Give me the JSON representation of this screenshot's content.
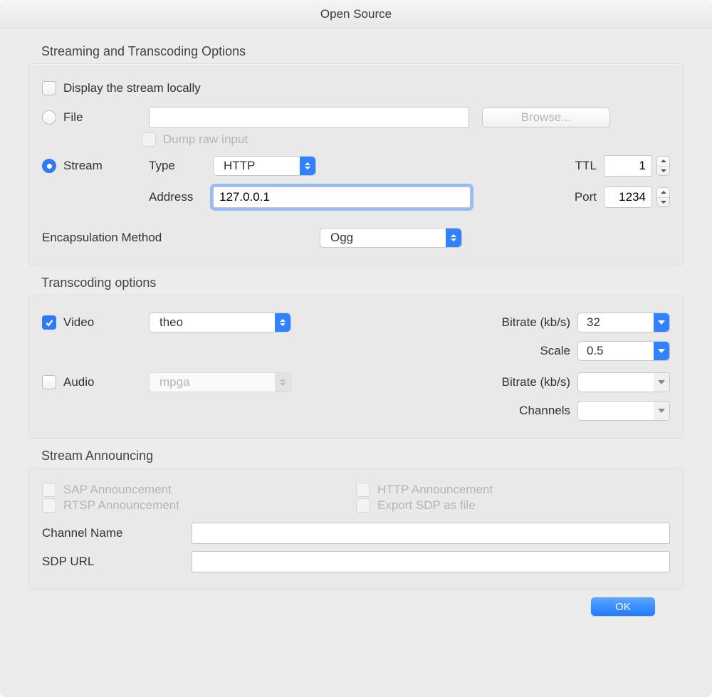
{
  "window": {
    "title": "Open Source"
  },
  "streaming": {
    "section_label": "Streaming and Transcoding Options",
    "display_locally": {
      "label": "Display the stream locally",
      "checked": false
    },
    "file": {
      "label": "File",
      "selected": false,
      "path": "",
      "browse_label": "Browse..."
    },
    "dump_raw": {
      "label": "Dump raw input",
      "checked": false,
      "enabled": false
    },
    "stream": {
      "label": "Stream",
      "selected": true,
      "type_label": "Type",
      "type_value": "HTTP",
      "ttl_label": "TTL",
      "ttl_value": "1",
      "address_label": "Address",
      "address_value": "127.0.0.1",
      "port_label": "Port",
      "port_value": "1234"
    },
    "encap": {
      "label": "Encapsulation Method",
      "value": "Ogg"
    }
  },
  "transcoding": {
    "section_label": "Transcoding options",
    "video": {
      "label": "Video",
      "checked": true,
      "codec": "theo",
      "bitrate_label": "Bitrate (kb/s)",
      "bitrate_value": "32",
      "scale_label": "Scale",
      "scale_value": "0.5"
    },
    "audio": {
      "label": "Audio",
      "checked": false,
      "codec": "mpga",
      "bitrate_label": "Bitrate (kb/s)",
      "bitrate_value": "",
      "channels_label": "Channels",
      "channels_value": ""
    }
  },
  "announcing": {
    "section_label": "Stream Announcing",
    "sap": {
      "label": "SAP Announcement",
      "checked": false,
      "enabled": false
    },
    "http": {
      "label": "HTTP Announcement",
      "checked": false,
      "enabled": false
    },
    "rtsp": {
      "label": "RTSP Announcement",
      "checked": false,
      "enabled": false
    },
    "export_sdp": {
      "label": "Export SDP as file",
      "checked": false,
      "enabled": false
    },
    "channel_name_label": "Channel Name",
    "channel_name_value": "",
    "sdp_url_label": "SDP URL",
    "sdp_url_value": ""
  },
  "footer": {
    "ok_label": "OK"
  }
}
